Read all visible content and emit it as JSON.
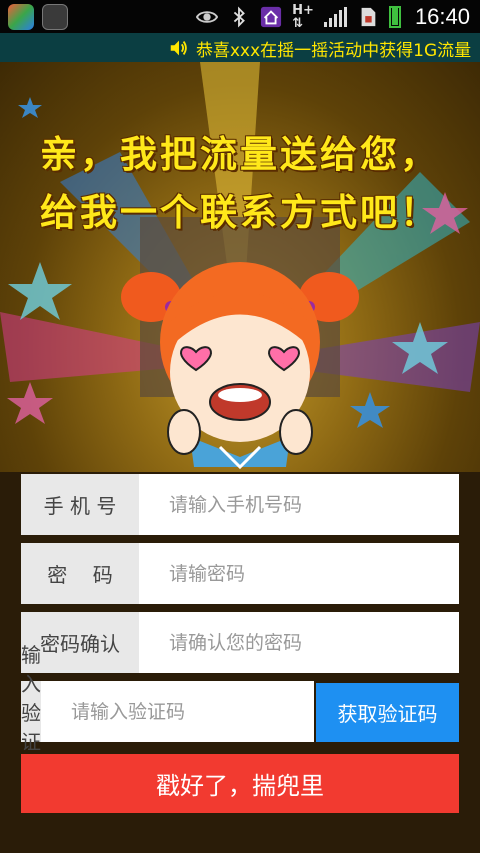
{
  "status_bar": {
    "time": "16:40",
    "network": "H+",
    "icons": [
      "app-icon",
      "app-icon-2",
      "eye-icon",
      "bluetooth-icon",
      "home-icon",
      "network-icon",
      "signal-icon",
      "sim-icon",
      "battery-icon"
    ]
  },
  "ticker": {
    "icon": "volume-icon",
    "text": "恭喜xxx在摇一摇活动中获得1G流量"
  },
  "hero": {
    "headline_line1": "亲，我把流量送给您，",
    "headline_line2": "给我一个联系方式吧！"
  },
  "form": {
    "phone": {
      "label": "手 机 号",
      "placeholder": "请输入手机号码"
    },
    "password": {
      "label": "密    码",
      "placeholder": "请输密码"
    },
    "confirm": {
      "label": "密码确认",
      "placeholder": "请确认您的密码"
    },
    "code": {
      "label": "输入验证码",
      "placeholder": "请输入验证码",
      "button": "获取验证码"
    },
    "submit": "戳好了，揣兜里"
  },
  "colors": {
    "ticker_bg": "#0b3e42",
    "ticker_text": "#ffe600",
    "headline": "#ffe81a",
    "getcode_bg": "#1e90f2",
    "submit_bg": "#f23a30"
  }
}
